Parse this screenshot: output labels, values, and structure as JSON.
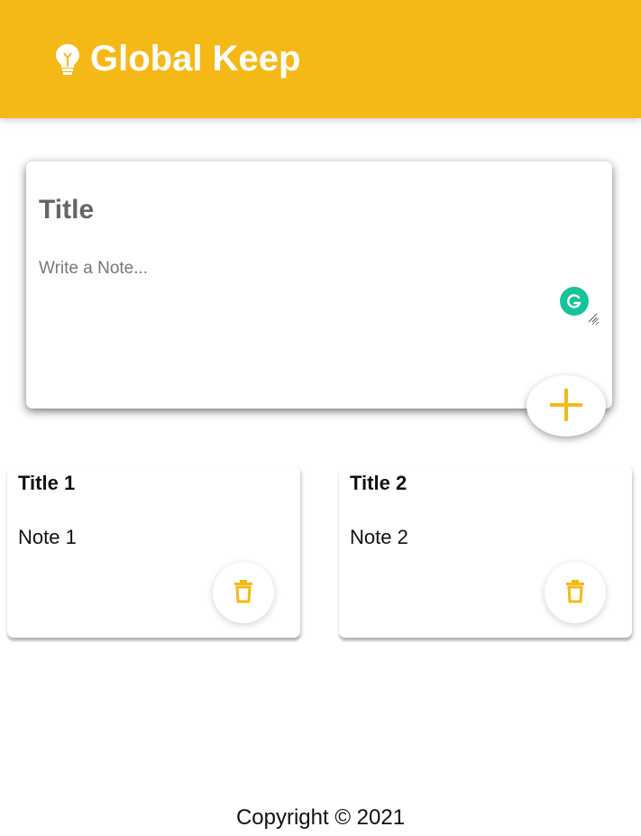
{
  "header": {
    "title": "Global Keep",
    "logo_icon": "lightbulb-icon"
  },
  "create_note": {
    "title_placeholder": "Title",
    "note_placeholder": "Write a Note...",
    "add_icon": "plus-icon",
    "grammarly_icon": "grammarly-icon"
  },
  "notes": [
    {
      "title": "Title 1",
      "content": "Note 1",
      "delete_icon": "trash-icon"
    },
    {
      "title": "Title 2",
      "content": "Note 2",
      "delete_icon": "trash-icon"
    }
  ],
  "footer": {
    "copyright": "Copyright © 2021"
  },
  "colors": {
    "accent": "#f5b917",
    "white": "#ffffff",
    "grammarly": "#15c39a"
  }
}
